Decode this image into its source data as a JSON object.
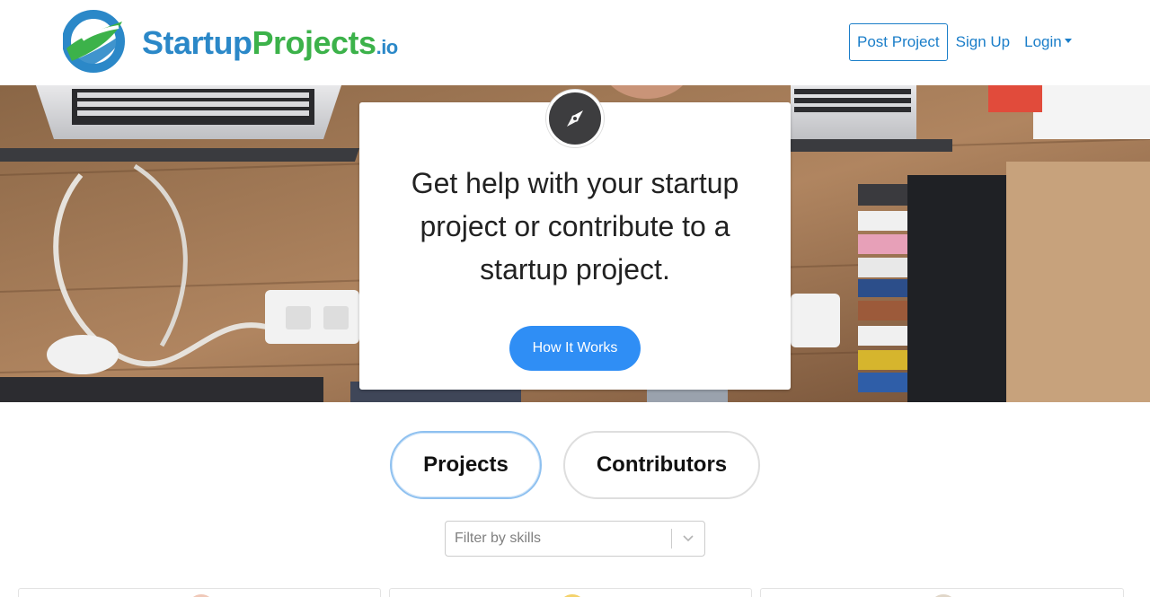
{
  "brand": {
    "name_part1": "Startup",
    "name_part2": "Projects",
    "name_part3": ".io"
  },
  "nav": {
    "post_project": "Post Project",
    "sign_up": "Sign Up",
    "login": "Login"
  },
  "hero": {
    "icon": "compass-icon",
    "headline": "Get help with your startup project or contribute to a startup project.",
    "cta": "How It Works"
  },
  "tabs": {
    "projects": "Projects",
    "contributors": "Contributors",
    "active": "projects"
  },
  "filter": {
    "placeholder": "Filter by skills"
  },
  "colors": {
    "brand_blue": "#2b88c8",
    "brand_green": "#3cb24a",
    "link_blue": "#1b7ec9",
    "cta_blue": "#2f8ef5"
  }
}
